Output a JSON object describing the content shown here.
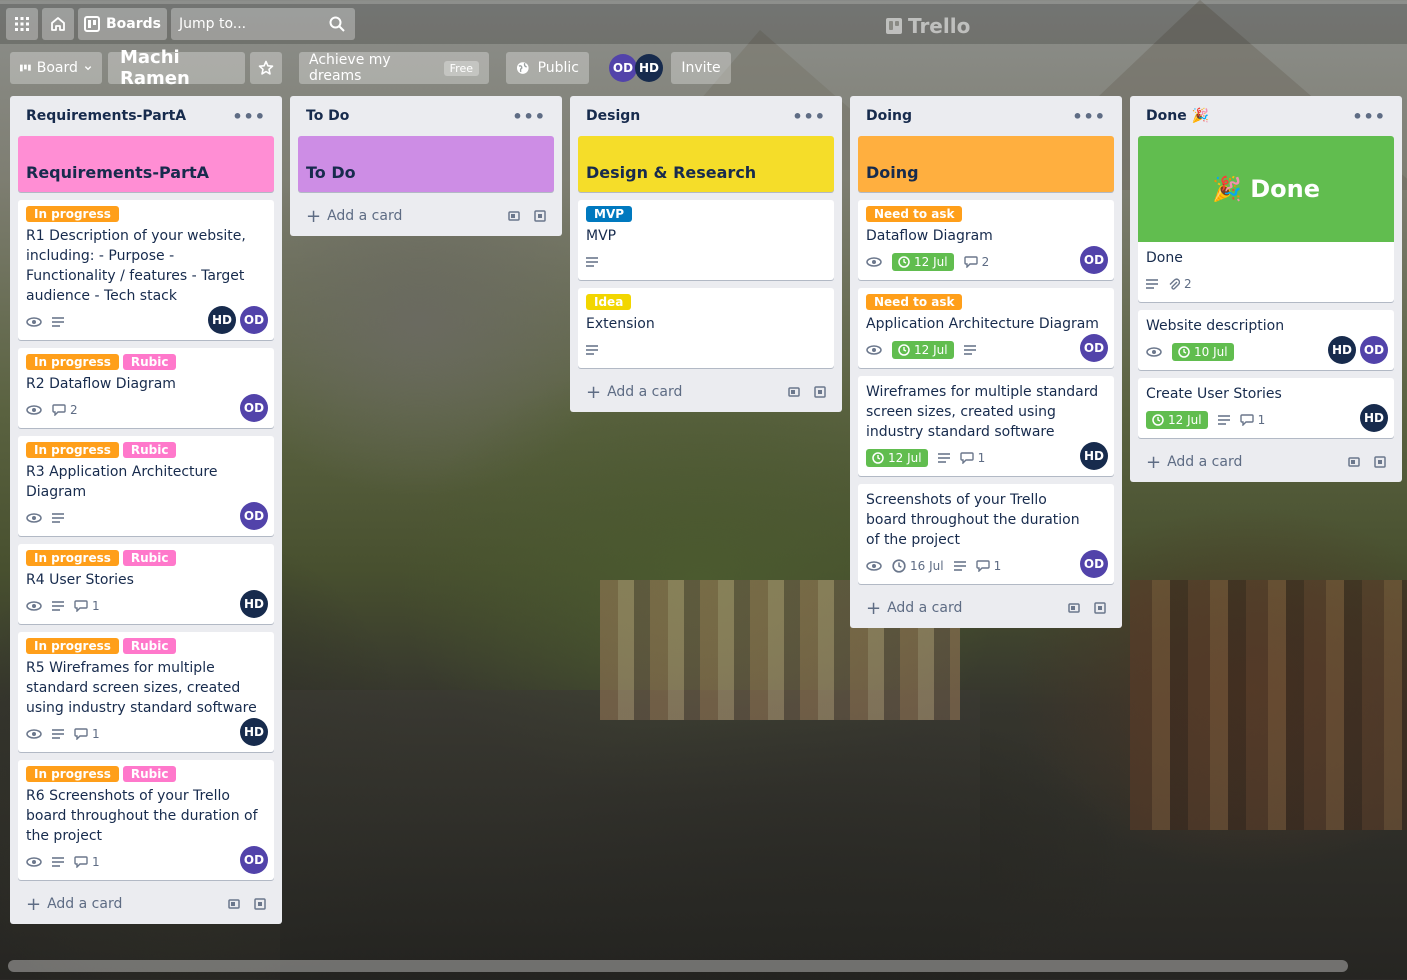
{
  "header": {
    "boards_label": "Boards",
    "search_placeholder": "Jump to...",
    "logo_text": "Trello"
  },
  "board_header": {
    "view_label": "Board",
    "board_name": "Machi Ramen",
    "workspace_label": "Achieve my dreams",
    "plan_badge": "Free",
    "visibility_label": "Public",
    "members": [
      "OD",
      "HD"
    ],
    "invite_label": "Invite"
  },
  "common": {
    "add_card": "Add a card"
  },
  "lists": [
    {
      "title": "Requirements-PartA",
      "cover": {
        "title": "Requirements-PartA",
        "color": "#ff8ed4"
      },
      "cards": [
        {
          "labels": [
            {
              "text": "In progress",
              "color": "#ff9f1a"
            }
          ],
          "title": "R1 Description of your website, including: - Purpose - Functionality / features - Target audience - Tech stack",
          "badges": {
            "watch": true,
            "desc": true
          },
          "members": [
            "HD",
            "OD"
          ]
        },
        {
          "labels": [
            {
              "text": "In progress",
              "color": "#ff9f1a"
            },
            {
              "text": "Rubic",
              "color": "#ff78cb"
            }
          ],
          "title": "R2 Dataflow Diagram",
          "badges": {
            "watch": true,
            "comments": "2"
          },
          "members": [
            "OD"
          ]
        },
        {
          "labels": [
            {
              "text": "In progress",
              "color": "#ff9f1a"
            },
            {
              "text": "Rubic",
              "color": "#ff78cb"
            }
          ],
          "title": "R3 Application Architecture Diagram",
          "badges": {
            "watch": true,
            "desc": true
          },
          "members": [
            "OD"
          ]
        },
        {
          "labels": [
            {
              "text": "In progress",
              "color": "#ff9f1a"
            },
            {
              "text": "Rubic",
              "color": "#ff78cb"
            }
          ],
          "title": "R4 User Stories",
          "badges": {
            "watch": true,
            "desc": true,
            "comments": "1"
          },
          "members": [
            "HD"
          ]
        },
        {
          "labels": [
            {
              "text": "In progress",
              "color": "#ff9f1a"
            },
            {
              "text": "Rubic",
              "color": "#ff78cb"
            }
          ],
          "title": "R5 Wireframes for multiple standard screen sizes, created using industry standard software",
          "badges": {
            "watch": true,
            "desc": true,
            "comments": "1"
          },
          "members": [
            "HD"
          ]
        },
        {
          "labels": [
            {
              "text": "In progress",
              "color": "#ff9f1a"
            },
            {
              "text": "Rubic",
              "color": "#ff78cb"
            }
          ],
          "title": "R6 Screenshots of your Trello board throughout the duration of the project",
          "badges": {
            "watch": true,
            "desc": true,
            "comments": "1"
          },
          "members": [
            "OD"
          ]
        }
      ]
    },
    {
      "title": "To Do",
      "cover": {
        "title": "To Do",
        "color": "#cd8de5"
      },
      "cards": []
    },
    {
      "title": "Design",
      "cover": {
        "title": "Design & Research",
        "color": "#f5dd29"
      },
      "cards": [
        {
          "labels": [
            {
              "text": "MVP",
              "color": "#0079bf"
            }
          ],
          "title": "MVP",
          "badges": {
            "desc": true
          },
          "members": []
        },
        {
          "labels": [
            {
              "text": "Idea",
              "color": "#f2d600"
            }
          ],
          "title": "Extension",
          "badges": {
            "desc": true
          },
          "members": []
        }
      ]
    },
    {
      "title": "Doing",
      "cover": {
        "title": "Doing",
        "color": "#ffaf3f"
      },
      "cards": [
        {
          "labels": [
            {
              "text": "Need to ask",
              "color": "#ff9f1a"
            }
          ],
          "title": "Dataflow Diagram",
          "badges": {
            "watch": true,
            "due": "12 Jul",
            "comments": "2"
          },
          "members": [
            "OD"
          ]
        },
        {
          "labels": [
            {
              "text": "Need to ask",
              "color": "#ff9f1a"
            }
          ],
          "title": "Application Architecture Diagram",
          "badges": {
            "watch": true,
            "due": "12 Jul",
            "desc": true
          },
          "members": [
            "OD"
          ]
        },
        {
          "labels": [],
          "title": "Wireframes for multiple standard screen sizes, created using industry standard software",
          "badges": {
            "due": "12 Jul",
            "desc": true,
            "comments": "1"
          },
          "members": [
            "HD"
          ]
        },
        {
          "labels": [],
          "title": "Screenshots of your Trello board throughout the duration of the project",
          "badges": {
            "watch": true,
            "date": "16 Jul",
            "desc": true,
            "comments": "1"
          },
          "members": [
            "OD"
          ]
        }
      ]
    },
    {
      "title": "Done 🎉",
      "cover": {
        "title": "🎉 Done",
        "color": "#61bd4f"
      },
      "cards": [
        {
          "labels": [],
          "title": "Done",
          "badges": {
            "desc": true,
            "attachments": "2"
          },
          "members": [],
          "is_cover_card": true
        },
        {
          "labels": [],
          "title": "Website description",
          "badges": {
            "watch": true,
            "due": "10 Jul"
          },
          "members": [
            "HD",
            "OD"
          ]
        },
        {
          "labels": [],
          "title": "Create User Stories",
          "badges": {
            "due": "12 Jul",
            "desc": true,
            "comments": "1"
          },
          "members": [
            "HD"
          ]
        }
      ]
    }
  ]
}
